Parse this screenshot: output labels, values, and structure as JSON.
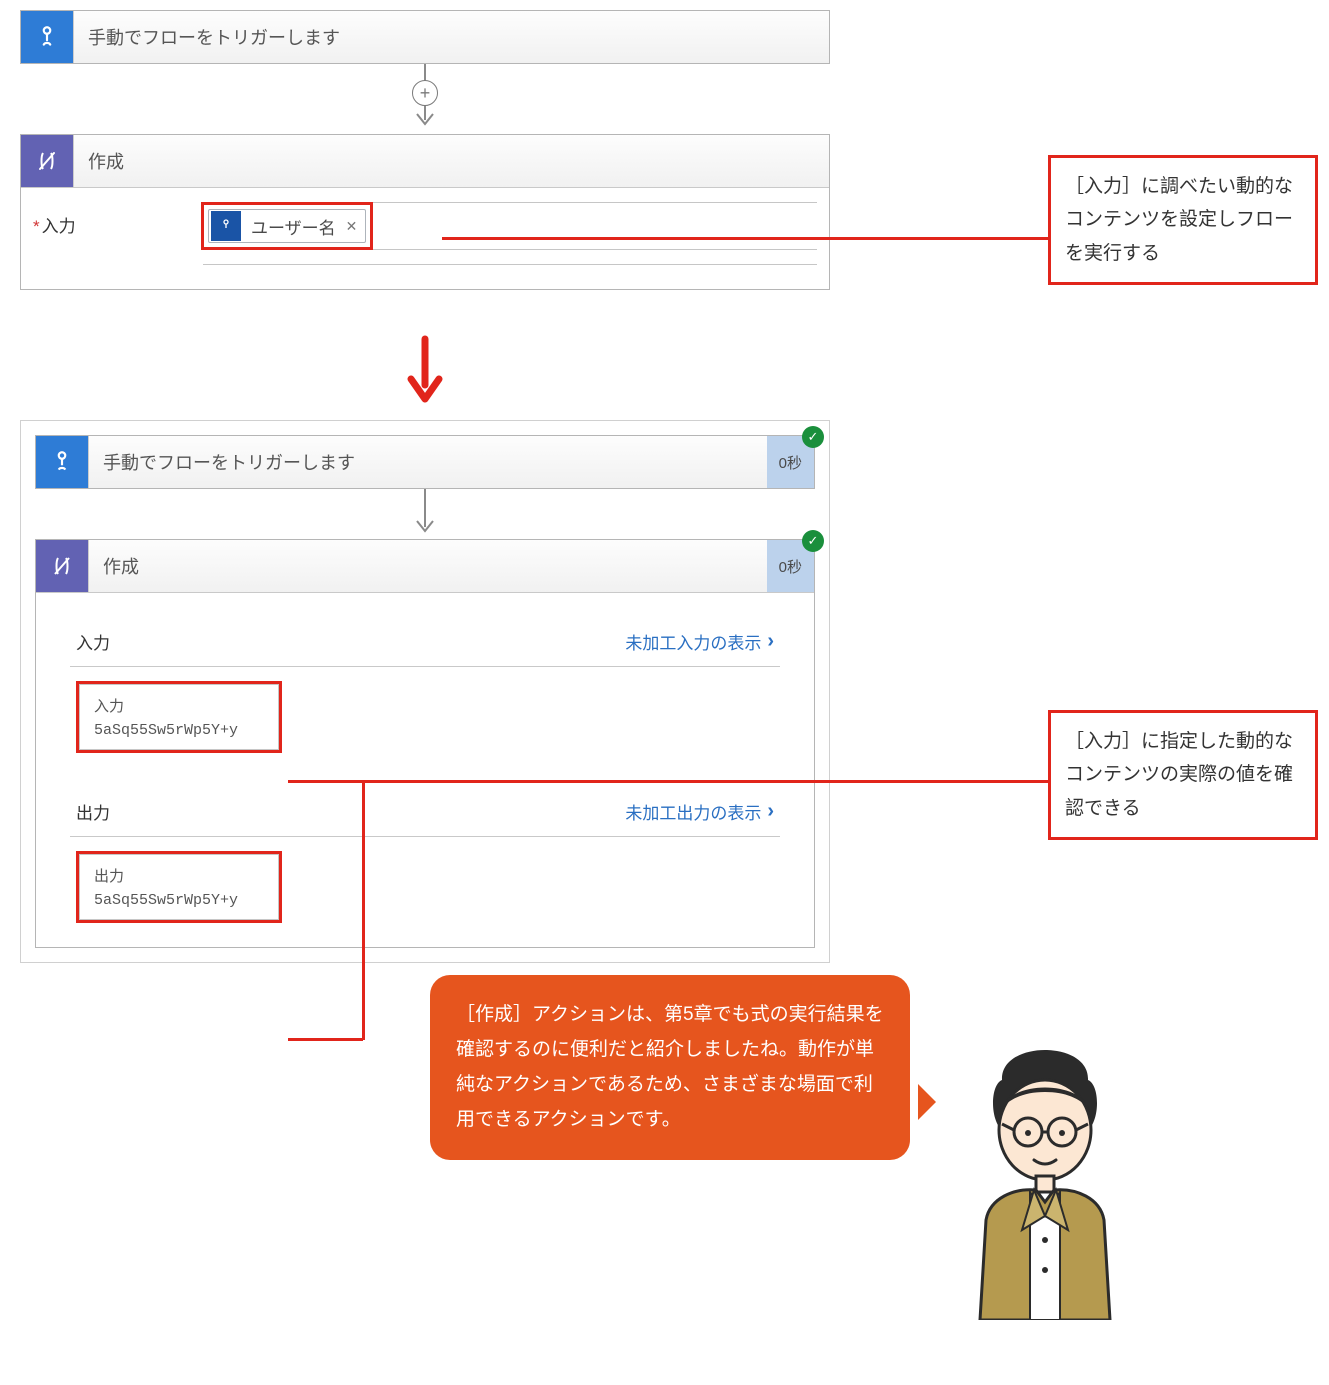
{
  "trigger": {
    "title": "手動でフローをトリガーします",
    "time": "0秒"
  },
  "compose": {
    "title": "作成",
    "time": "0秒",
    "input_label": "入力",
    "required_mark": "*",
    "token_label": "ユーザー名",
    "close_glyph": "✕"
  },
  "result": {
    "sections": {
      "input_header": "入力",
      "input_raw_link": "未加工入力の表示",
      "output_header": "出力",
      "output_raw_link": "未加工出力の表示"
    },
    "input_field_label": "入力",
    "input_value": "5aSq55Sw5rWp5Y+y",
    "output_field_label": "出力",
    "output_value": "5aSq55Sw5rWp5Y+y"
  },
  "callouts": {
    "c1": "［入力］に調べたい動的なコンテンツを設定しフローを実行する",
    "c2": "［入力］に指定した動的なコンテンツの実際の値を確認できる"
  },
  "bubble": "［作成］アクションは、第5章でも式の実行結果を確認するのに便利だと紹介しましたね。動作が単純なアクションであるため、さまざまな場面で利用できるアクションです。",
  "glyphs": {
    "plus": "+",
    "check": "✓",
    "arrow_down": "↓",
    "chevron": "›"
  }
}
